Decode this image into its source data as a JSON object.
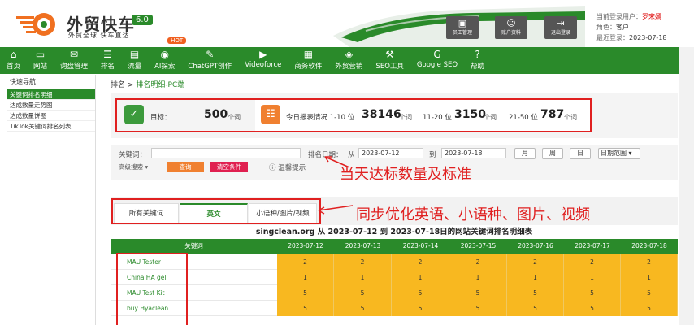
{
  "header": {
    "brand": "外贸快车",
    "version": "6.0",
    "slogan": "外贸全球 快车直达",
    "buttons": [
      {
        "label": "员工管理",
        "icon": "staff-icon"
      },
      {
        "label": "账户资料",
        "icon": "account-icon"
      },
      {
        "label": "退出登录",
        "icon": "logout-icon"
      }
    ],
    "user": {
      "current_label": "当前登录用户：",
      "current_value": "罗宋嫣",
      "role_label": "角色：",
      "role_value": "客户",
      "last_login_label": "最近登录：",
      "last_login_value": "2023-07-18"
    }
  },
  "nav": {
    "hot_badge": "HOT",
    "items": [
      {
        "label": "首页",
        "icon": "home-icon"
      },
      {
        "label": "网站",
        "icon": "monitor-icon"
      },
      {
        "label": "询盘管理",
        "icon": "mail-icon"
      },
      {
        "label": "排名",
        "icon": "rank-icon"
      },
      {
        "label": "流量",
        "icon": "traffic-icon"
      },
      {
        "label": "AI探索",
        "icon": "ai-icon"
      },
      {
        "label": "ChatGPT创作",
        "icon": "chatgpt-icon"
      },
      {
        "label": "Videoforce",
        "icon": "video-icon"
      },
      {
        "label": "商务软件",
        "icon": "software-icon"
      },
      {
        "label": "外贸营销",
        "icon": "marketing-icon"
      },
      {
        "label": "SEO工具",
        "icon": "seo-tool-icon"
      },
      {
        "label": "Google SEO",
        "icon": "google-icon"
      },
      {
        "label": "帮助",
        "icon": "help-icon"
      }
    ]
  },
  "sidebar": {
    "title": "快速导航",
    "items": [
      {
        "label": "关键词排名明细"
      },
      {
        "label": "达成数量走势图"
      },
      {
        "label": "达成数量饼图"
      },
      {
        "label": "TikTok关键词排名列表"
      }
    ]
  },
  "breadcrumb": {
    "root": "排名",
    "sep": ">",
    "current": "排名明细-PC端"
  },
  "stats": {
    "target_label": "目标：",
    "target_value": "500",
    "unit": "个词",
    "today_label": "今日报表情况 1-10 位",
    "today_v1": "38146",
    "mid_label": "11-20 位",
    "today_v2": "3150",
    "far_label": "21-50 位",
    "today_v3": "787"
  },
  "filter": {
    "keyword_label": "关键词：",
    "keyword_value": "",
    "date_label": "排名日期：",
    "from_label": "从",
    "from_date": "2023-07-12",
    "to_label": "到",
    "to_date": "2023-07-18",
    "month_btn": "月",
    "week_btn": "周",
    "day_btn": "日",
    "range_select": "日期范围",
    "advanced": "高级搜索",
    "search_btn": "查询",
    "clear_btn": "清空条件",
    "tip": "温馨提示"
  },
  "annotations": {
    "a1": "当天达标数量及标准",
    "a2": "同步优化英语、小语种、图片、视频"
  },
  "tabs": [
    {
      "label": "所有关键词"
    },
    {
      "label": "英文"
    },
    {
      "label": "小语种/图片/视频"
    }
  ],
  "table": {
    "title": "singclean.org 从 2023-07-12 到 2023-07-18日的网站关键词排名明细表",
    "kw_header": "关键词",
    "dates": [
      "2023-07-12",
      "2023-07-13",
      "2023-07-14",
      "2023-07-15",
      "2023-07-16",
      "2023-07-17",
      "2023-07-18"
    ],
    "rows": [
      {
        "kw": "MAU Tester",
        "vals": [
          "2",
          "2",
          "2",
          "2",
          "2",
          "2",
          "2"
        ]
      },
      {
        "kw": "China HA gel",
        "vals": [
          "1",
          "1",
          "1",
          "1",
          "1",
          "1",
          "1"
        ]
      },
      {
        "kw": "MAU Test Kit",
        "vals": [
          "5",
          "5",
          "5",
          "5",
          "5",
          "5",
          "5"
        ]
      },
      {
        "kw": "buy Hyaclean",
        "vals": [
          "5",
          "5",
          "5",
          "5",
          "5",
          "5",
          "5"
        ]
      }
    ]
  },
  "colors": {
    "brand_green": "#2a8a2a",
    "accent_orange": "#f08030",
    "annotation_red": "#e02020",
    "cell_yellow": "#f8b820"
  }
}
